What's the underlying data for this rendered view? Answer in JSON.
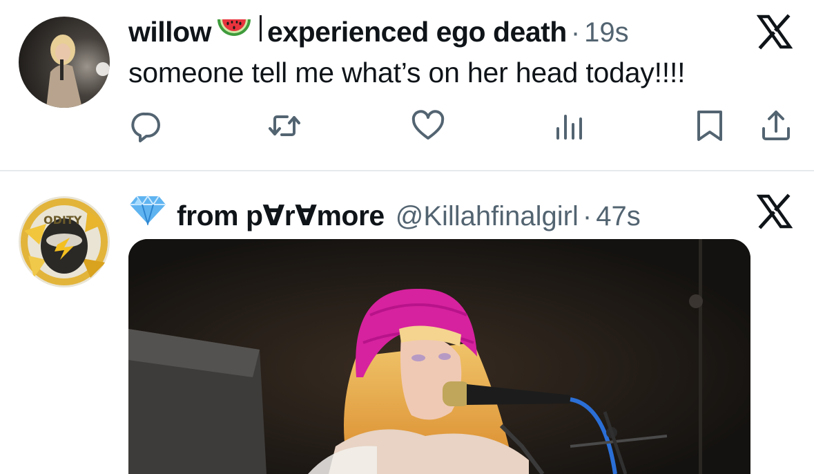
{
  "tweets": [
    {
      "display_name": "willow",
      "name_emoji": "watermelon-emoji",
      "name_suffix": "experienced ego death",
      "separator": "·",
      "time": "19s",
      "text": "someone tell me what’s on her head today!!!!",
      "avatar": "avatar-performer-photo",
      "actions": [
        "reply-icon",
        "retweet-icon",
        "like-icon",
        "views-icon",
        "bookmark-icon",
        "share-icon"
      ]
    },
    {
      "display_name": "from p∀r∀more",
      "name_emoji": "gem-emoji",
      "handle": "@Killahfinalgirl",
      "separator": "·",
      "time": "47s",
      "avatar": "avatar-yellow-graphic",
      "media": "photo-singer-pink-beanie-microphone"
    }
  ],
  "colors": {
    "text": "#0f1419",
    "secondary": "#536471",
    "divider": "#e6e9eb",
    "icon": "#536471",
    "beanie": "#d6229e"
  }
}
